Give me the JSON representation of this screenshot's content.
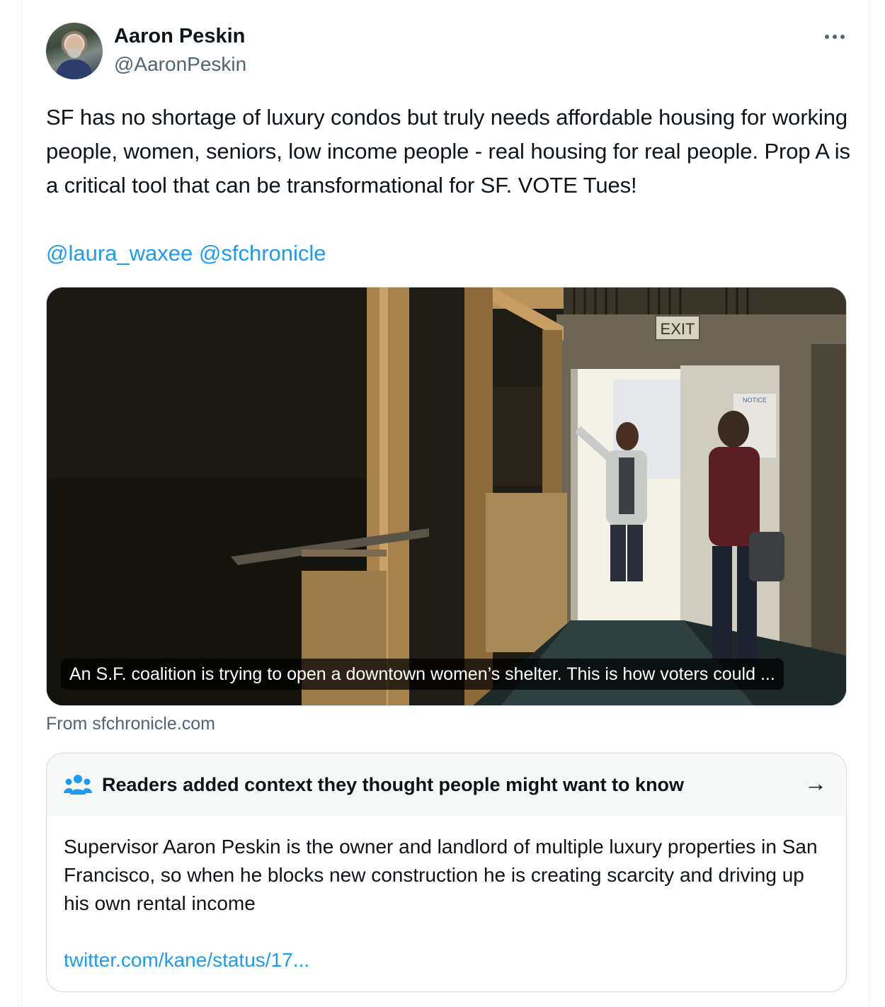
{
  "author": {
    "name": "Aaron Peskin",
    "handle": "@AaronPeskin",
    "avatar_icon": "profile-photo"
  },
  "tweet": {
    "text": "SF has no shortage of luxury condos but truly needs affordable housing for working people, women, seniors, low income people - real housing for real people. Prop A is a critical tool that can be transformational for SF. VOTE Tues!",
    "mentions": [
      "@laura_waxee",
      "@sfchronicle"
    ]
  },
  "link_card": {
    "caption": "An S.F. coalition is trying to open a downtown women’s shelter. This is how voters could ...",
    "exit_sign": "EXIT",
    "notice_sign": "NOTICE",
    "source": "From sfchronicle.com"
  },
  "community_note": {
    "title": "Readers added context they thought people might want to know",
    "body": "Supervisor Aaron Peskin is the owner and landlord of multiple luxury properties in San Francisco, so when he blocks new construction he is creating scarcity and driving up his own rental income",
    "link": "twitter.com/kane/status/17...",
    "arrow": "→"
  },
  "colors": {
    "link": "#1d9bf0",
    "secondary_text": "#536471",
    "note_icon": "#1d9bf0"
  }
}
